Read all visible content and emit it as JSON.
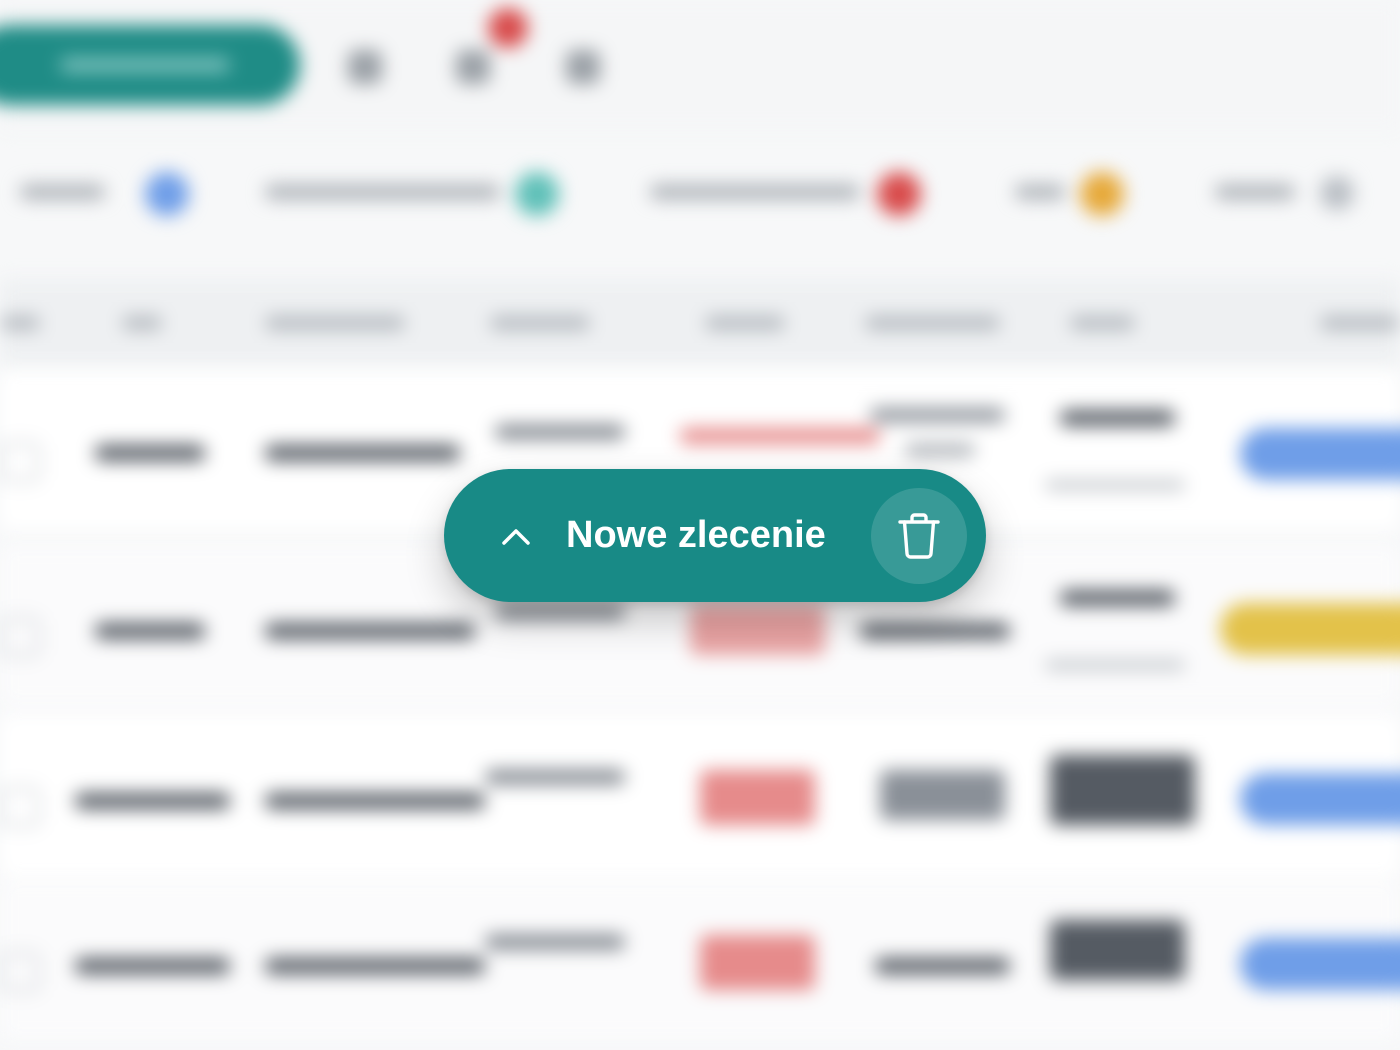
{
  "action_bar": {
    "label": "Nowe zlecenie",
    "toggle_icon": "chevron-up-icon",
    "delete_icon": "trash-icon",
    "background_color": "#188a86",
    "text_color": "#ffffff"
  },
  "background": {
    "blurred": true,
    "accent_color": "#1f8c86",
    "status_colors": [
      "#6f9ee8",
      "#2aa59c",
      "#d84b4b",
      "#e6a93a"
    ]
  }
}
